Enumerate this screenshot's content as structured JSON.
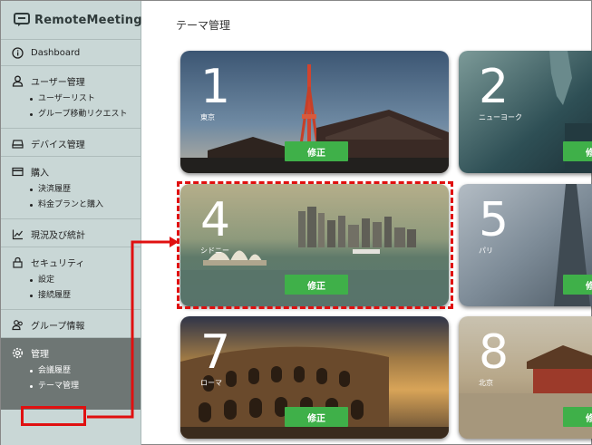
{
  "app": {
    "logo_text": "RemoteMeeting"
  },
  "sidebar": {
    "dashboard": "Dashboard",
    "users": {
      "title": "ユーザー管理",
      "items": [
        "ユーザーリスト",
        "グループ移動リクエスト"
      ]
    },
    "devices": "デバイス管理",
    "purchase": {
      "title": "購入",
      "items": [
        "決済履歴",
        "料金プランと購入"
      ]
    },
    "stats": "現況及び統計",
    "security": {
      "title": "セキュリティ",
      "items": [
        "設定",
        "接続履歴"
      ]
    },
    "group": "グループ情報",
    "admin": {
      "title": "管理",
      "items": [
        "会議履歴",
        "テーマ管理"
      ]
    }
  },
  "main": {
    "title": "テーマ管理",
    "edit_label": "修正",
    "themes": [
      {
        "num": "1",
        "city": "東京"
      },
      {
        "num": "2",
        "city": "ニューヨーク"
      },
      {
        "num": "4",
        "city": "シドニー"
      },
      {
        "num": "5",
        "city": "パリ"
      },
      {
        "num": "7",
        "city": "ローマ"
      },
      {
        "num": "8",
        "city": "北京"
      }
    ]
  },
  "colors": {
    "sidebar_bg": "#c9d7d6",
    "active_bg": "#6e7674",
    "accent_green": "#3fb049",
    "annotation_red": "#e01010"
  }
}
